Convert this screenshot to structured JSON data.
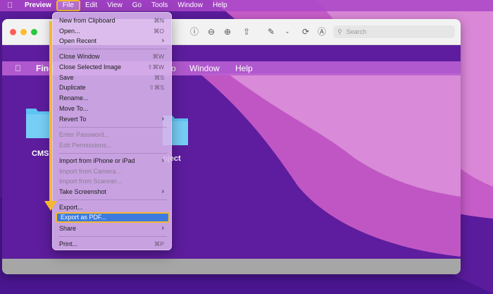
{
  "menubar": {
    "app_name": "Preview",
    "items": [
      "File",
      "Edit",
      "View",
      "Go",
      "Tools",
      "Window",
      "Help"
    ]
  },
  "toolbar": {
    "search_placeholder": "Search"
  },
  "inner_screenshot": {
    "menu_items": [
      "Find",
      "o",
      "Window",
      "Help"
    ],
    "folder_labels": [
      "CMS",
      "oject"
    ]
  },
  "file_menu": {
    "items": [
      {
        "label": "New from Clipboard",
        "shortcut": "⌘N"
      },
      {
        "label": "Open...",
        "shortcut": "⌘O"
      },
      {
        "label": "Open Recent",
        "submenu": true
      },
      {
        "label": "Close Window",
        "shortcut": "⌘W"
      },
      {
        "label": "Close Selected Image",
        "shortcut": "⇧⌘W"
      },
      {
        "label": "Save",
        "shortcut": "⌘S"
      },
      {
        "label": "Duplicate",
        "shortcut": "⇧⌘S"
      },
      {
        "label": "Rename...",
        "shortcut": ""
      },
      {
        "label": "Move To...",
        "shortcut": ""
      },
      {
        "label": "Revert To",
        "submenu": true
      },
      {
        "label": "Enter Password...",
        "disabled": true
      },
      {
        "label": "Edit Permissions...",
        "disabled": true
      },
      {
        "label": "Import from iPhone or iPad",
        "submenu": true
      },
      {
        "label": "Import from Camera...",
        "disabled": true
      },
      {
        "label": "Import from Scanner...",
        "disabled": true
      },
      {
        "label": "Take Screenshot",
        "submenu": true
      },
      {
        "label": "Export...",
        "shortcut": ""
      },
      {
        "label": "Export as PDF...",
        "highlighted": true
      },
      {
        "label": "Share",
        "submenu": true
      },
      {
        "label": "Print...",
        "shortcut": "⌘P"
      }
    ]
  },
  "colors": {
    "accent_annotation": "#f5b731",
    "menu_highlight": "#3b7be0"
  }
}
